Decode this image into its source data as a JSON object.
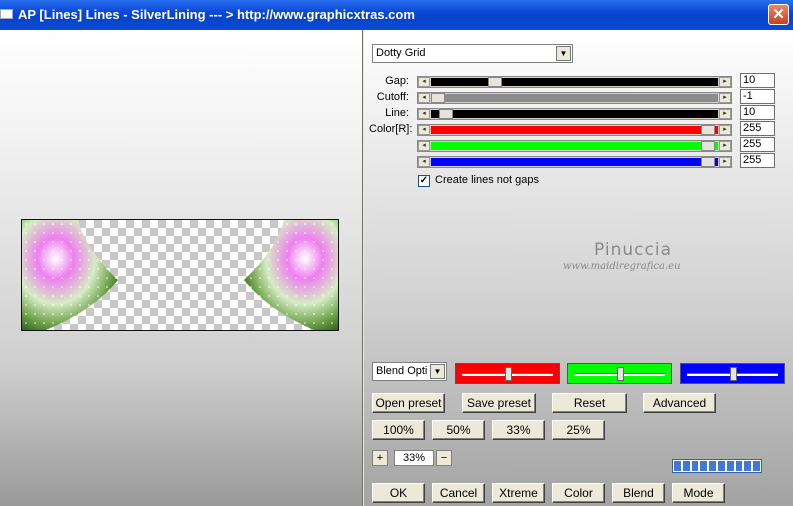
{
  "window": {
    "title": "AP [Lines]  Lines - SilverLining    --- > http://www.graphicxtras.com",
    "close_glyph": "✕"
  },
  "preset_combo": {
    "value": "Dotty Grid"
  },
  "sliders": [
    {
      "label": "Gap:",
      "value": "10",
      "track_color": "#000000",
      "fraction": 0.21
    },
    {
      "label": "Cutoff:",
      "value": "-1",
      "track_color": "#8c8c8c",
      "fraction": 0.0
    },
    {
      "label": "Line:",
      "value": "10",
      "track_color": "#000000",
      "fraction": 0.03
    },
    {
      "label": "Color[R]:",
      "value": "255",
      "track_color": "#ff0000",
      "fraction": 0.99
    },
    {
      "label": "",
      "value": "255",
      "track_color": "#00ff00",
      "fraction": 0.99
    },
    {
      "label": "",
      "value": "255",
      "track_color": "#0000ff",
      "fraction": 0.99
    }
  ],
  "checkbox": {
    "label": "Create lines not gaps",
    "checked": true,
    "mark": "✓"
  },
  "watermark": {
    "line1": "Pinuccia",
    "line2": "www.maidiregrafica.eu"
  },
  "blend_combo": {
    "value": "Blend Opti"
  },
  "color_boxes": [
    {
      "color": "#ff0000",
      "fraction": 0.5
    },
    {
      "color": "#00ff00",
      "fraction": 0.5
    },
    {
      "color": "#0000ff",
      "fraction": 0.5
    }
  ],
  "buttons": {
    "open_preset": "Open preset",
    "save_preset": "Save preset",
    "reset": "Reset",
    "advanced": "Advanced",
    "zoom100": "100%",
    "zoom50": "50%",
    "zoom33": "33%",
    "zoom25": "25%",
    "ok": "OK",
    "cancel": "Cancel",
    "xtreme": "Xtreme",
    "color": "Color",
    "blend": "Blend",
    "mode": "Mode"
  },
  "zoom": {
    "plus": "+",
    "value": "33%",
    "minus": "−"
  },
  "progress": {
    "segments": 10
  }
}
